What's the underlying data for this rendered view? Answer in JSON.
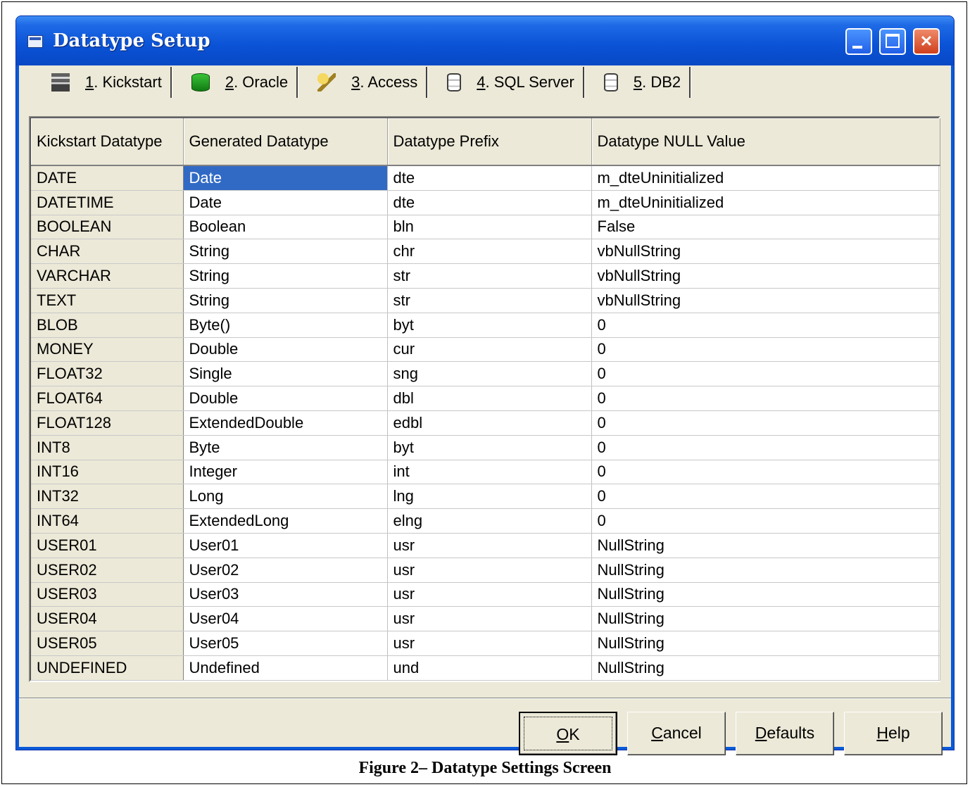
{
  "window": {
    "title": "Datatype Setup",
    "accent_color": "#0a5ad8",
    "selection_color": "#316ac5"
  },
  "tabs": [
    {
      "key": "1",
      "label": ". Kickstart",
      "icon": "kickstart-icon"
    },
    {
      "key": "2",
      "label": ". Oracle",
      "icon": "database-icon"
    },
    {
      "key": "3",
      "label": ". Access",
      "icon": "key-icon"
    },
    {
      "key": "4",
      "label": ". SQL Server",
      "icon": "cylinder-icon"
    },
    {
      "key": "5",
      "label": ". DB2",
      "icon": "cylinder-icon"
    }
  ],
  "grid": {
    "headers": [
      "Kickstart Datatype",
      "Generated Datatype",
      "Datatype Prefix",
      "Datatype NULL Value"
    ],
    "rows": [
      [
        "DATE",
        "Date",
        "dte",
        "m_dteUninitialized"
      ],
      [
        "DATETIME",
        "Date",
        "dte",
        "m_dteUninitialized"
      ],
      [
        "BOOLEAN",
        "Boolean",
        "bln",
        "False"
      ],
      [
        "CHAR",
        "String",
        "chr",
        "vbNullString"
      ],
      [
        "VARCHAR",
        "String",
        "str",
        "vbNullString"
      ],
      [
        "TEXT",
        "String",
        "str",
        "vbNullString"
      ],
      [
        "BLOB",
        "Byte()",
        "byt",
        "0"
      ],
      [
        "MONEY",
        "Double",
        "cur",
        "0"
      ],
      [
        "FLOAT32",
        "Single",
        "sng",
        "0"
      ],
      [
        "FLOAT64",
        "Double",
        "dbl",
        "0"
      ],
      [
        "FLOAT128",
        "ExtendedDouble",
        "edbl",
        "0"
      ],
      [
        "INT8",
        "Byte",
        "byt",
        "0"
      ],
      [
        "INT16",
        "Integer",
        "int",
        "0"
      ],
      [
        "INT32",
        "Long",
        "lng",
        "0"
      ],
      [
        "INT64",
        "ExtendedLong",
        "elng",
        "0"
      ],
      [
        "USER01",
        "User01",
        "usr",
        "NullString"
      ],
      [
        "USER02",
        "User02",
        "usr",
        "NullString"
      ],
      [
        "USER03",
        "User03",
        "usr",
        "NullString"
      ],
      [
        "USER04",
        "User04",
        "usr",
        "NullString"
      ],
      [
        "USER05",
        "User05",
        "usr",
        "NullString"
      ],
      [
        "UNDEFINED",
        "Undefined",
        "und",
        "NullString"
      ]
    ]
  },
  "buttons": {
    "ok": {
      "mnemonic": "O",
      "rest": "K"
    },
    "cancel": {
      "mnemonic": "C",
      "rest": "ancel"
    },
    "defaults": {
      "mnemonic": "D",
      "rest": "efaults"
    },
    "help": {
      "mnemonic": "H",
      "rest": "elp"
    }
  },
  "caption": "Figure 2– Datatype Settings Screen"
}
